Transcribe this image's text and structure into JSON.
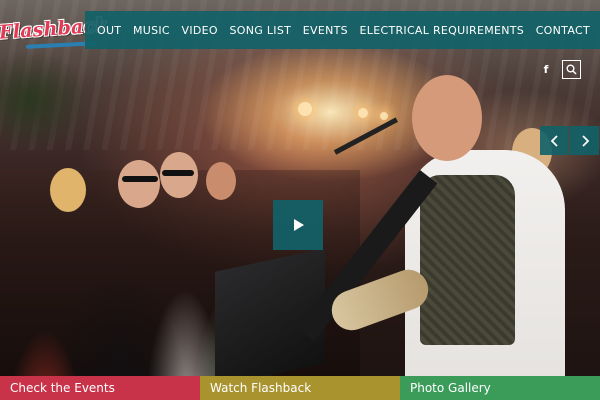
{
  "brand": {
    "logo_text": "Flashback"
  },
  "nav": {
    "items": [
      {
        "label": "ABOUT",
        "visible_label": "OUT"
      },
      {
        "label": "MUSIC"
      },
      {
        "label": "VIDEO"
      },
      {
        "label": "SONG LIST"
      },
      {
        "label": "EVENTS"
      },
      {
        "label": "ELECTRICAL REQUIREMENTS"
      },
      {
        "label": "CONTACT"
      }
    ]
  },
  "social": {
    "facebook_glyph": "f",
    "icons": [
      "facebook-icon",
      "search-icon"
    ]
  },
  "slider": {
    "prev_icon": "chevron-left-icon",
    "next_icon": "chevron-right-icon",
    "play_icon": "play-icon"
  },
  "cta": {
    "events_label": "Check the Events",
    "watch_label": "Watch Flashback",
    "gallery_label": "Photo Gallery"
  },
  "colors": {
    "nav_bg": "#116268",
    "logo": "#e23a55",
    "cta_events": "#c8334a",
    "cta_watch": "#a8932f",
    "cta_gallery": "#3b9c5a"
  }
}
